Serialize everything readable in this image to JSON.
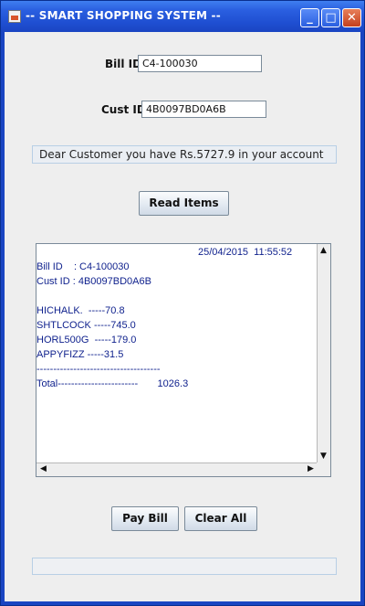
{
  "window": {
    "title": "-- SMART SHOPPING SYSTEM --",
    "min_glyph": "_",
    "max_glyph": "□",
    "close_glyph": "✕"
  },
  "form": {
    "bill_id_label": "Bill ID",
    "bill_id_value": "C4-100030",
    "cust_id_label": "Cust ID",
    "cust_id_value": "4B0097BD0A6B"
  },
  "info_message": "Dear Customer you have Rs.5727.9 in your account",
  "buttons": {
    "read_items": "Read Items",
    "pay_bill": "Pay Bill",
    "clear_all": "Clear All"
  },
  "receipt": {
    "timestamp": "25/04/2015  11:55:52",
    "bill_line": "Bill ID    : C4-100030",
    "cust_line": "Cust ID : 4B0097BD0A6B",
    "items": [
      "HICHALK.  -----70.8",
      "SHTLCOCK -----745.0",
      "HORL500G  -----179.0",
      "APPYFIZZ -----31.5"
    ],
    "separator": "-------------------------------------",
    "total_line": "Total------------------------       1026.3"
  },
  "scroll_glyphs": {
    "up": "▲",
    "down": "▼",
    "left": "◀",
    "right": "▶"
  },
  "progress": {
    "value": 0
  }
}
